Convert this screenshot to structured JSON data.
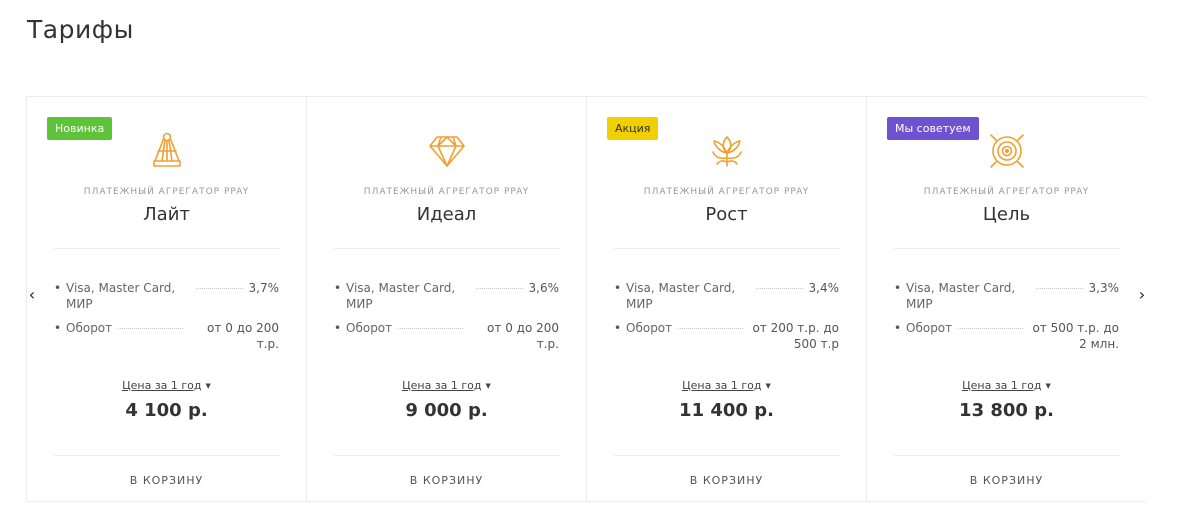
{
  "page": {
    "title": "Тарифы"
  },
  "colors": {
    "new": "#5ec339",
    "promo": "#f0d000",
    "recommend": "#6f52cf",
    "icon": "#f0a030"
  },
  "cards": [
    {
      "badge": "Новинка",
      "badge_color": "#5ec339",
      "icon": "shuttlecock-icon",
      "subtitle": "ПЛАТЕЖНЫЙ АГРЕГАТОР PPAY",
      "name": "Лайт",
      "props": [
        {
          "name": "Visa, Master Card, МИР",
          "value": "3,7%"
        },
        {
          "name": "Оборот",
          "value": "от 0 до 200 т.р."
        }
      ],
      "price_label": "Цена за 1 год",
      "price": "4 100 р.",
      "cart": "В КОРЗИНУ"
    },
    {
      "badge": "",
      "badge_color": "",
      "icon": "diamond-icon",
      "subtitle": "ПЛАТЕЖНЫЙ АГРЕГАТОР PPAY",
      "name": "Идеал",
      "props": [
        {
          "name": "Visa, Master Card, МИР",
          "value": "3,6%"
        },
        {
          "name": "Оборот",
          "value": "от 0 до 200 т.р."
        }
      ],
      "price_label": "Цена за 1 год",
      "price": "9 000 р.",
      "cart": "В КОРЗИНУ"
    },
    {
      "badge": "Акция",
      "badge_color": "#f0d000",
      "icon": "flower-icon",
      "subtitle": "ПЛАТЕЖНЫЙ АГРЕГАТОР PPAY",
      "name": "Рост",
      "props": [
        {
          "name": "Visa, Master Card, МИР",
          "value": "3,4%"
        },
        {
          "name": "Оборот",
          "value": "от 200 т.р. до 500 т.р"
        }
      ],
      "price_label": "Цена за 1 год",
      "price": "11 400 р.",
      "cart": "В КОРЗИНУ"
    },
    {
      "badge": "Мы советуем",
      "badge_color": "#6f52cf",
      "icon": "target-icon",
      "subtitle": "ПЛАТЕЖНЫЙ АГРЕГАТОР PPAY",
      "name": "Цель",
      "props": [
        {
          "name": "Visa, Master Card, МИР",
          "value": "3,3%"
        },
        {
          "name": "Оборот",
          "value": "от 500 т.р. до 2 млн."
        }
      ],
      "price_label": "Цена за 1 год",
      "price": "13 800 р.",
      "cart": "В КОРЗИНУ"
    }
  ],
  "nav": {
    "prev": "‹",
    "next": "›"
  }
}
